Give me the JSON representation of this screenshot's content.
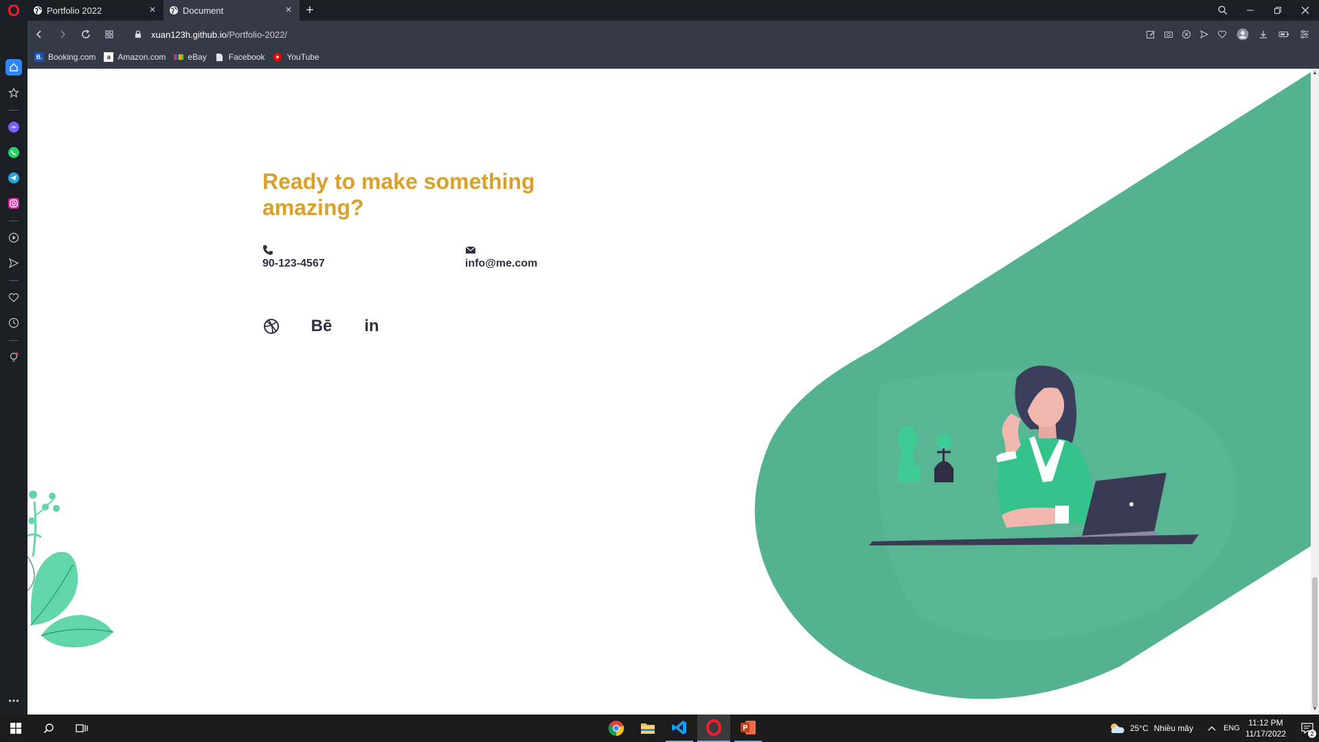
{
  "browser": {
    "tabs": [
      {
        "label": "Portfolio 2022",
        "active": false
      },
      {
        "label": "Document",
        "active": true
      }
    ],
    "url": {
      "host": "xuan123h.github.io",
      "path": "/Portfolio-2022/"
    },
    "bookmarks": [
      {
        "label": "Booking.com",
        "icon": "B."
      },
      {
        "label": "Amazon.com",
        "icon": "a"
      },
      {
        "label": "eBay",
        "icon": "ebay-icon"
      },
      {
        "label": "Facebook",
        "icon": "document-icon"
      },
      {
        "label": "YouTube",
        "icon": "youtube-icon"
      }
    ]
  },
  "page": {
    "headline": "Ready to make something amazing?",
    "phone": "90-123-4567",
    "email": "info@me.com",
    "social": [
      {
        "name": "dribbble-icon"
      },
      {
        "name": "behance-icon",
        "glyph": "Bē"
      },
      {
        "name": "linkedin-icon",
        "glyph": "in"
      }
    ],
    "colors": {
      "accent": "#d9a02b",
      "green": "#54b290",
      "text": "#2f3040"
    }
  },
  "taskbar": {
    "weather": "25°C",
    "weather_desc": "Nhiều mây",
    "lang": "ENG",
    "time": "11:12 PM",
    "date": "11/17/2022",
    "notifications": "2"
  }
}
